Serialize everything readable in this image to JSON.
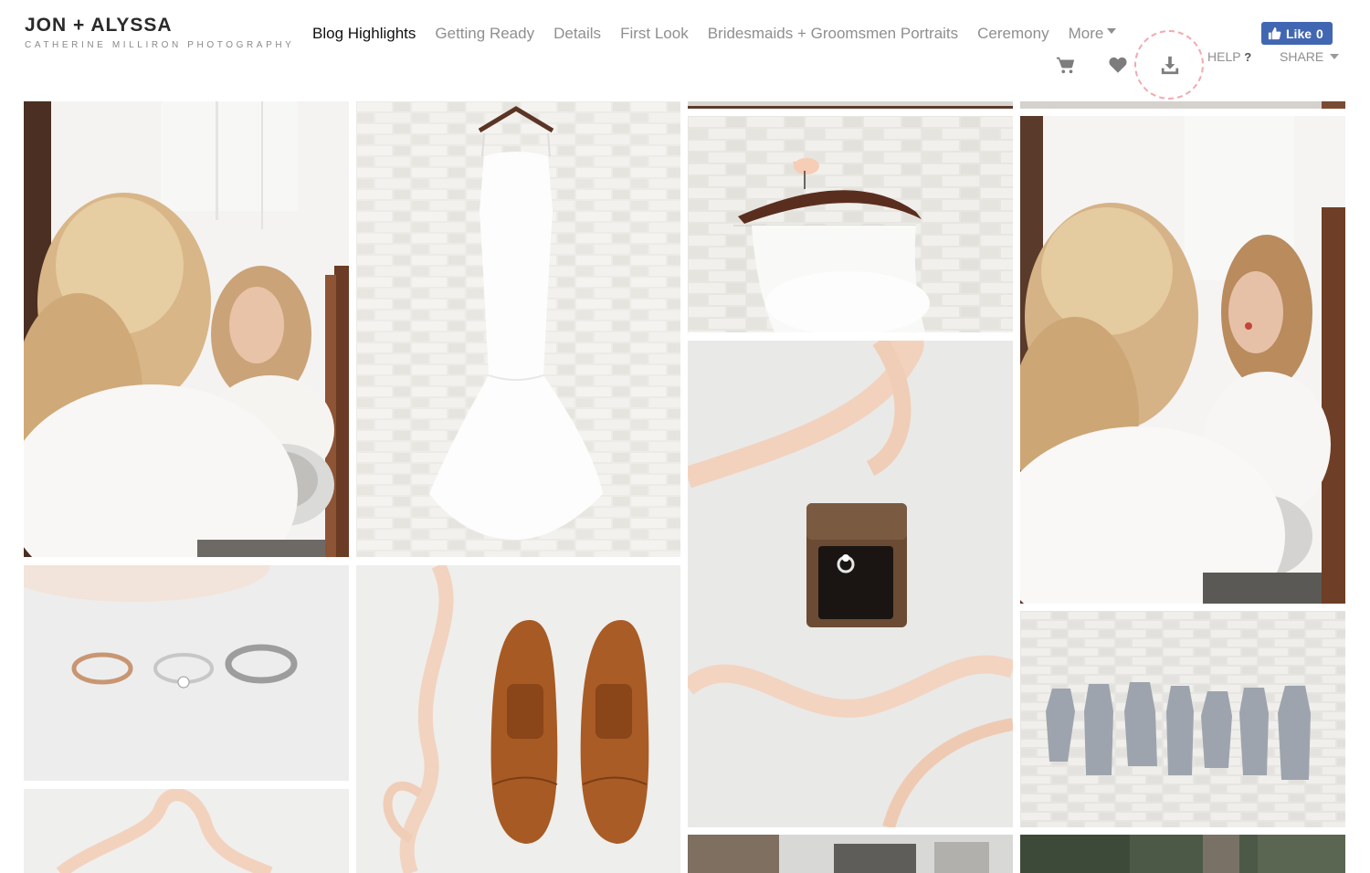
{
  "brand": {
    "title": "JON + ALYSSA",
    "subtitle": "CATHERINE MILLIRON PHOTOGRAPHY"
  },
  "nav": {
    "items": [
      {
        "label": "Blog Highlights",
        "active": true
      },
      {
        "label": "Getting Ready",
        "active": false
      },
      {
        "label": "Details",
        "active": false
      },
      {
        "label": "First Look",
        "active": false
      },
      {
        "label": "Bridesmaids + Groomsmen Portraits",
        "active": false
      },
      {
        "label": "Ceremony",
        "active": false
      }
    ],
    "more_label": "More"
  },
  "facebook": {
    "like_label": "Like",
    "count": "0"
  },
  "toolbar": {
    "icons": [
      "cart-icon",
      "heart-icon",
      "download-icon"
    ],
    "help_label": "HELP",
    "help_mark": "?",
    "share_label": "SHARE"
  },
  "colors": {
    "accent": "#4267b2",
    "highlight_ring": "#f1aab0",
    "nav_inactive": "#8f8f8f",
    "nav_active": "#111111"
  },
  "gallery": {
    "photos": [
      "bride-applying-lipstick-mirror",
      "wedding-dress-on-hanger",
      "dress-top-on-hanger-top-crop",
      "dress-hanger-with-bow",
      "ring-box-with-ribbon",
      "bride-mirror-second-top-crop",
      "bride-mirror-second",
      "three-rings",
      "brown-dress-shoes",
      "bridesmaid-dresses-on-wall",
      "ribbon-bottom",
      "house-exterior-bottom",
      "trees-bottom"
    ]
  }
}
